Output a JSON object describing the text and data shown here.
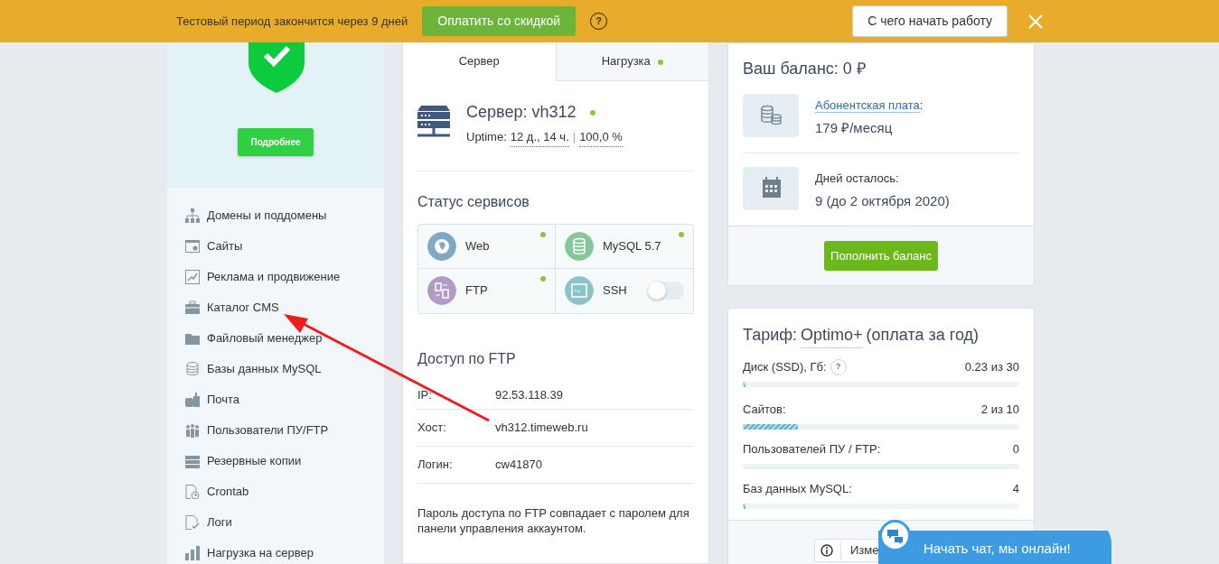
{
  "banner": {
    "message": "Тестовый период закончится через 9 дней",
    "pay_button": "Оплатить со скидкой",
    "help": "?",
    "start_button": "С чего начать работу"
  },
  "sidebar": {
    "promo_button": "Подробнее",
    "items": [
      {
        "label": "Домены и поддомены"
      },
      {
        "label": "Сайты"
      },
      {
        "label": "Реклама и продвижение"
      },
      {
        "label": "Каталог CMS"
      },
      {
        "label": "Файловый менеджер"
      },
      {
        "label": "Базы данных MySQL"
      },
      {
        "label": "Почта"
      },
      {
        "label": "Пользователи ПУ/FTP"
      },
      {
        "label": "Резервные копии"
      },
      {
        "label": "Crontab"
      },
      {
        "label": "Логи"
      },
      {
        "label": "Нагрузка на сервер"
      }
    ]
  },
  "server_card": {
    "tabs": [
      {
        "label": "Сервер",
        "selected": true,
        "online": false
      },
      {
        "label": "Нагрузка",
        "selected": false,
        "online": true
      }
    ],
    "server": {
      "title": "Сервер: vh312",
      "online": true,
      "uptime_label": "Uptime:",
      "uptime": "12 д., 14 ч.",
      "separator": "|",
      "availability": "100,0 %"
    },
    "services_title": "Статус сервисов",
    "services": [
      {
        "name": "Web",
        "kind": "status",
        "online": true,
        "color": "#7fa9c4"
      },
      {
        "name": "MySQL 5.7",
        "kind": "status",
        "online": true,
        "color": "#86c69b"
      },
      {
        "name": "FTP",
        "kind": "status",
        "online": true,
        "color": "#b19cc4"
      },
      {
        "name": "SSH",
        "kind": "toggle",
        "on": false,
        "color": "#8ac4c8"
      }
    ],
    "ftp": {
      "title": "Доступ по FTP",
      "rows": [
        {
          "label": "IP:",
          "value": "92.53.118.39"
        },
        {
          "label": "Хост:",
          "value": "vh312.timeweb.ru"
        },
        {
          "label": "Логин:",
          "value": "cw41870"
        }
      ],
      "note": "Пароль доступа по FTP совпадает с паролем для панели управления аккаунтом."
    }
  },
  "balance": {
    "title": "Ваш баланс: 0 ₽",
    "fee_label": "Абонентская плата",
    "fee_colon": ":",
    "fee_value": "179 ₽/месяц",
    "days_label": "Дней осталось:",
    "days_value": "9 (до 2 октября 2020)",
    "button": "Пополнить баланс"
  },
  "tariff": {
    "title_prefix": "Тариф:",
    "plan": "Optimo+",
    "title_suffix": "(оплата за год)",
    "rows": [
      {
        "label": "Диск (SSD), Гб:",
        "help": "?",
        "value": "0.23 из 30",
        "level": 0.01
      },
      {
        "label": "Сайтов:",
        "value": "2 из 10",
        "level": 0.2
      },
      {
        "label": "Пользователей ПУ / FTP:",
        "value": "0",
        "level": 0
      },
      {
        "label": "Баз данных MySQL:",
        "value": "4",
        "level": 0.01
      }
    ],
    "footer_button": "Изме"
  },
  "chat": {
    "label": "Начать чат, мы онлайн!"
  }
}
